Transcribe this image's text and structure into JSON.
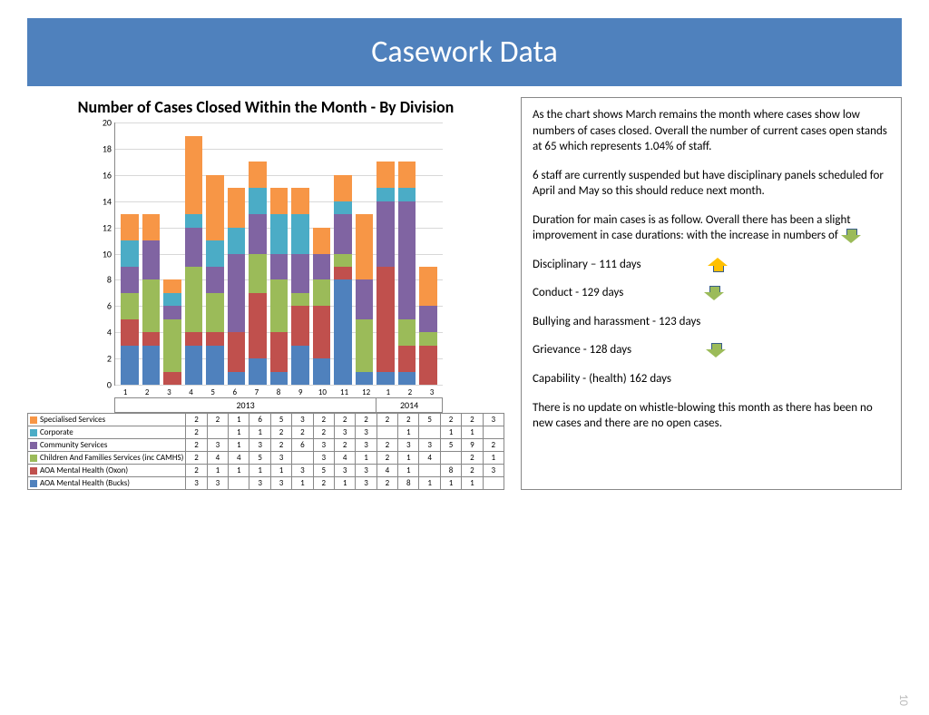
{
  "title": "Casework Data",
  "chart_data": {
    "type": "bar",
    "stacked": true,
    "title": "Number of Cases Closed Within the Month - By Division",
    "ylim": [
      0,
      20
    ],
    "yticks": [
      0,
      2,
      4,
      6,
      8,
      10,
      12,
      14,
      16,
      18,
      20
    ],
    "categories": [
      "1",
      "2",
      "3",
      "4",
      "5",
      "6",
      "7",
      "8",
      "9",
      "10",
      "11",
      "12",
      "1",
      "2",
      "3"
    ],
    "year_groups": [
      {
        "label": "2013",
        "span": 12
      },
      {
        "label": "2014",
        "span": 3
      }
    ],
    "series": [
      {
        "name": "AOA Mental Health (Bucks)",
        "color": "#4f81bd",
        "values": [
          3,
          3,
          null,
          3,
          3,
          1,
          2,
          1,
          3,
          2,
          8,
          1,
          1,
          1,
          null
        ]
      },
      {
        "name": "AOA Mental Health (Oxon)",
        "color": "#c0504d",
        "values": [
          2,
          1,
          1,
          1,
          1,
          3,
          5,
          3,
          3,
          4,
          1,
          null,
          8,
          2,
          3
        ]
      },
      {
        "name": "Children And Families Services (inc CAMHS)",
        "color": "#9bbb59",
        "values": [
          2,
          4,
          4,
          5,
          3,
          null,
          3,
          4,
          1,
          2,
          1,
          4,
          null,
          2,
          1
        ]
      },
      {
        "name": "Community Services",
        "color": "#8064a2",
        "values": [
          2,
          3,
          1,
          3,
          2,
          6,
          3,
          2,
          3,
          2,
          3,
          3,
          5,
          9,
          2
        ]
      },
      {
        "name": "Corporate",
        "color": "#4bacc6",
        "values": [
          2,
          null,
          1,
          1,
          2,
          2,
          2,
          3,
          3,
          null,
          1,
          null,
          1,
          1,
          null
        ]
      },
      {
        "name": "Specialised Services",
        "color": "#f79646",
        "values": [
          2,
          2,
          1,
          6,
          5,
          3,
          2,
          2,
          2,
          2,
          2,
          5,
          2,
          2,
          3
        ]
      }
    ]
  },
  "commentary": {
    "p1": "As  the chart shows March remains the month where cases show low numbers of cases closed.  Overall the number of current cases  open stands at 65 which represents  1.04% of staff.",
    "p2": "6 staff are currently suspended but have disciplinary panels scheduled for April and May so this should reduce next month.",
    "p3": "Duration for main cases is as follow.  Overall there has been a slight improvement in case durations:  with the increase in numbers of",
    "d1": "Disciplinary – 111 days",
    "d2": "Conduct -  129 days",
    "d3": "Bullying and harassment -  123 days",
    "d4": "Grievance -   128 days",
    "d5": "Capability -  (health) 162 days",
    "p4": "There is no update on whistle-blowing this month as there has been no new cases and there are no open cases."
  },
  "page_number": "10"
}
